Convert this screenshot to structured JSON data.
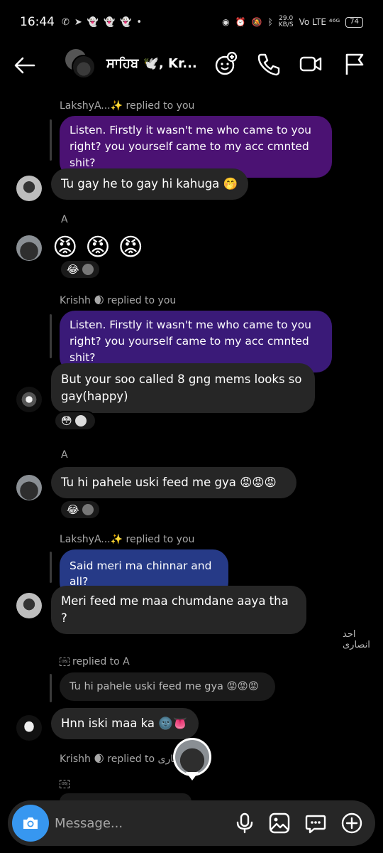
{
  "status": {
    "time": "16:44",
    "left_icons": [
      "whatsapp-icon",
      "telegram-icon",
      "snapchat-icon",
      "snapchat-icon",
      "snapchat-icon",
      "dot"
    ],
    "net_speed": "29.0",
    "net_unit": "KB/S",
    "signal": "Vo LTE ⁴⁶ᴳ",
    "battery": "74"
  },
  "header": {
    "title": "ਸਾਹਿਬ 🕊️, Kr..."
  },
  "messages": {
    "m1_reply_label": "LakshyA...✨ replied to you",
    "m1_quote": "Listen. Firstly it wasn't me who came to you right? you yourself came to my acc cmnted shit?",
    "m2_text": "Tu gay he to gay hi kahuga 🤭",
    "m3_sender": "A",
    "m3_emoji": "😡 😡 😡",
    "m3_reactions": "😂",
    "m4_reply_label": "Krishh 🌒 replied to you",
    "m4_quote": "Listen. Firstly it wasn't me who came to you right? you yourself came to my acc cmnted shit?",
    "m5_text": "But your soo called 8 gng mems looks so gay(happy)",
    "m5_reactions": "😳",
    "m6_sender": "A",
    "m6_text": "Tu hi pahele uski feed me gya 😡😡😡",
    "m6_reactions": "😂",
    "m7_reply_label": "LakshyA...✨ replied to you",
    "m7_quote": "Said meri ma chinnar and all?",
    "m8_text": "Meri feed me maa chumdane aaya tha ?",
    "rtl_name": "احد انصاری",
    "m9_reply_label": "replied to A",
    "m9_quote": "Tu hi pahele uski feed me gya 😡😡😡",
    "m10_text": "Hnn iski maa ka 🌚👅",
    "m11_reply_label": "Krishh 🌒 replied to ضاری"
  },
  "composer": {
    "placeholder": "Message..."
  }
}
